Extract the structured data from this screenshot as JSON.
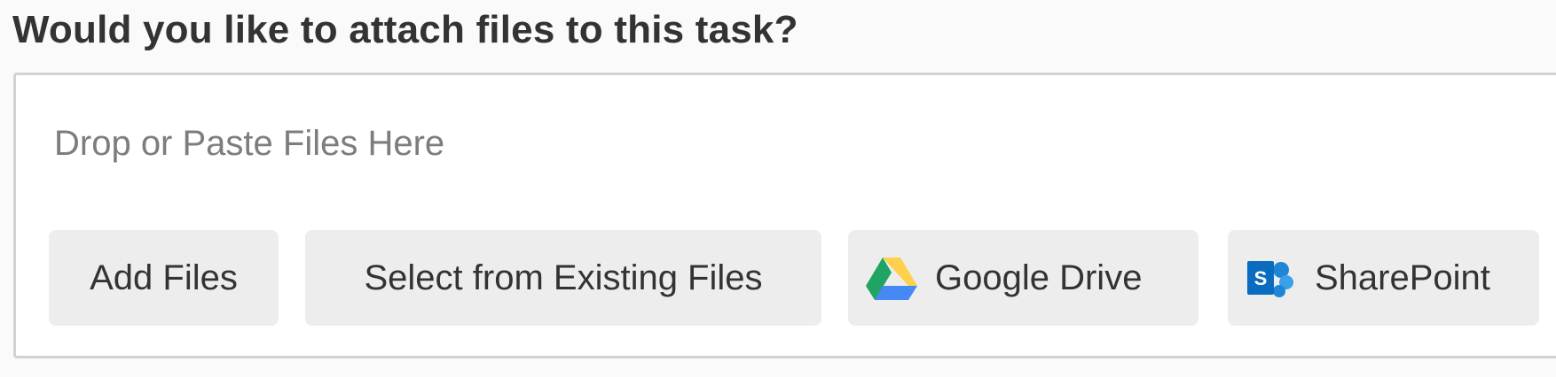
{
  "question": "Would you like to attach files to this task?",
  "dropzone": {
    "hint": "Drop or Paste Files Here"
  },
  "buttons": {
    "add_files": "Add Files",
    "select_existing": "Select from Existing Files",
    "google_drive": "Google Drive",
    "sharepoint": "SharePoint"
  },
  "icons": {
    "google_drive": "google-drive-icon",
    "sharepoint": "sharepoint-icon"
  },
  "colors": {
    "text_primary": "#333333",
    "hint_text": "#7d7d7d",
    "button_bg": "#ededed",
    "border": "#d2d2d2",
    "gdrive_green": "#1fa463",
    "gdrive_yellow": "#ffd04b",
    "gdrive_blue": "#4688f4",
    "sharepoint_blue": "#0b6cbf"
  }
}
